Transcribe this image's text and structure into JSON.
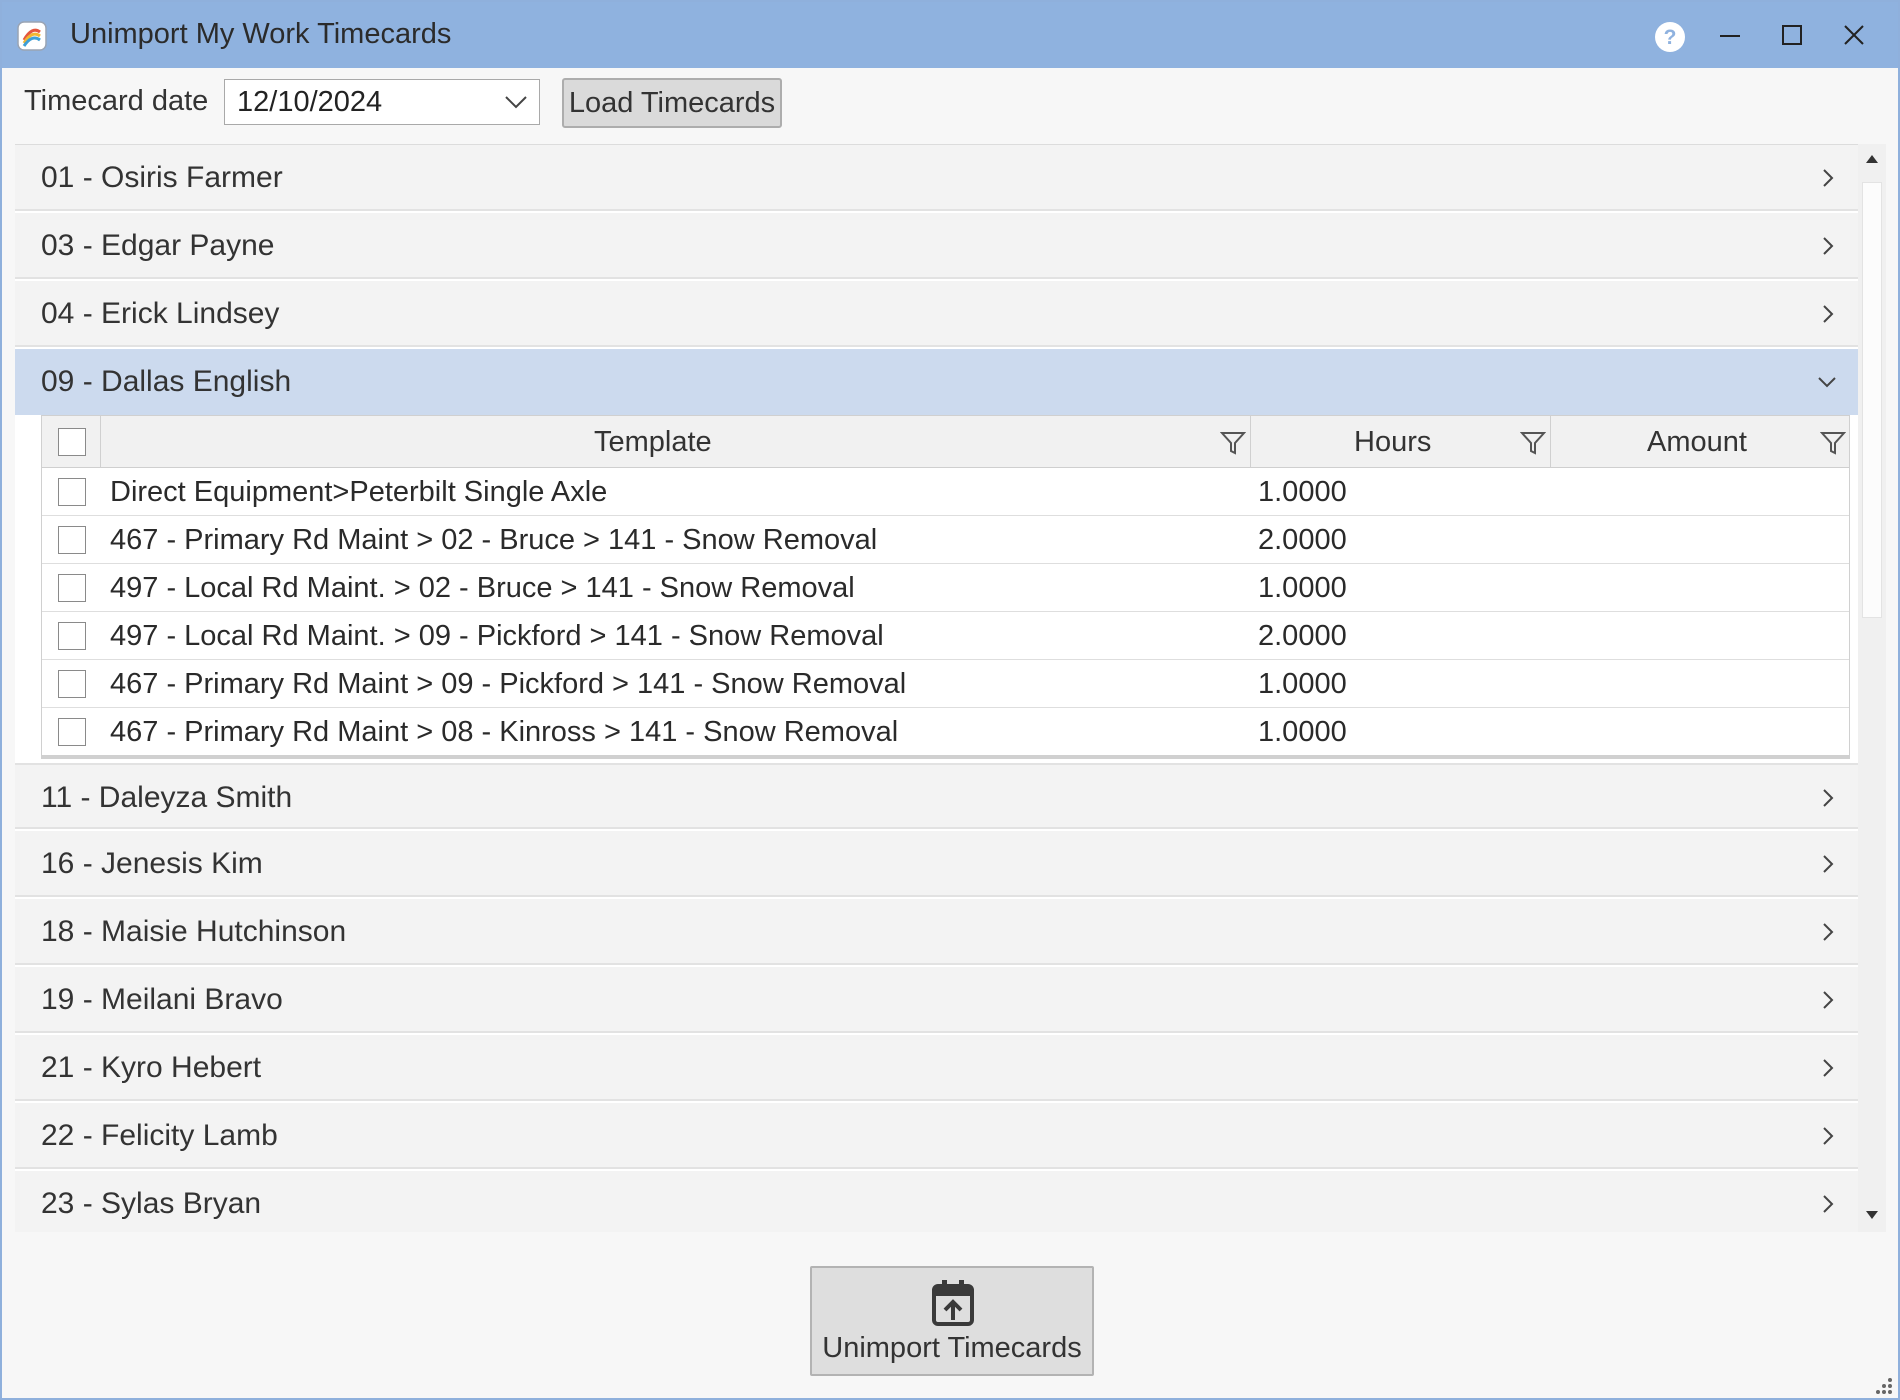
{
  "window": {
    "title": "Unimport My Work Timecards",
    "help_label": "?"
  },
  "toolbar": {
    "date_label": "Timecard date",
    "date_value": "12/10/2024",
    "load_label": "Load Timecards"
  },
  "employees": [
    {
      "label": "01 - Osiris Farmer",
      "expanded": false
    },
    {
      "label": "03 - Edgar Payne",
      "expanded": false
    },
    {
      "label": "04 - Erick Lindsey",
      "expanded": false
    },
    {
      "label": "09 - Dallas English",
      "expanded": true
    },
    {
      "label": "11 - Daleyza Smith",
      "expanded": false
    },
    {
      "label": "16 - Jenesis Kim",
      "expanded": false
    },
    {
      "label": "18 - Maisie Hutchinson",
      "expanded": false
    },
    {
      "label": "19 - Meilani Bravo",
      "expanded": false
    },
    {
      "label": "21 - Kyro Hebert",
      "expanded": false
    },
    {
      "label": "22 - Felicity Lamb",
      "expanded": false
    },
    {
      "label": "23 - Sylas Bryan",
      "expanded": false
    }
  ],
  "grid": {
    "columns": [
      "Template",
      "Hours",
      "Amount"
    ],
    "rows": [
      {
        "template": "Direct Equipment>Peterbilt Single Axle",
        "hours": "1.0000",
        "amount": ""
      },
      {
        "template": "467 - Primary Rd Maint > 02 - Bruce > 141 - Snow Removal",
        "hours": "2.0000",
        "amount": ""
      },
      {
        "template": "497 - Local Rd Maint. > 02 - Bruce > 141 - Snow Removal",
        "hours": "1.0000",
        "amount": ""
      },
      {
        "template": "497 - Local Rd Maint. > 09 - Pickford > 141 - Snow Removal",
        "hours": "2.0000",
        "amount": ""
      },
      {
        "template": "467 - Primary Rd Maint > 09 - Pickford > 141 - Snow Removal",
        "hours": "1.0000",
        "amount": ""
      },
      {
        "template": "467 - Primary Rd Maint > 08 - Kinross > 141 - Snow Removal",
        "hours": "1.0000",
        "amount": ""
      }
    ]
  },
  "footer": {
    "unimport_label": "Unimport Timecards"
  },
  "icons": {
    "app": "app-logo-icon",
    "help": "help-icon",
    "minimize": "minimize-icon",
    "maximize": "maximize-icon",
    "close": "close-icon",
    "dropdown": "chevron-down-icon",
    "collapsed": "chevron-right-icon",
    "expanded": "chevron-down-icon",
    "filter": "filter-icon",
    "unimport": "calendar-upload-icon"
  },
  "colors": {
    "titlebar": "#8fb2df",
    "expanded_row": "#ccdaee",
    "collapsed_row": "#f3f3f3"
  }
}
